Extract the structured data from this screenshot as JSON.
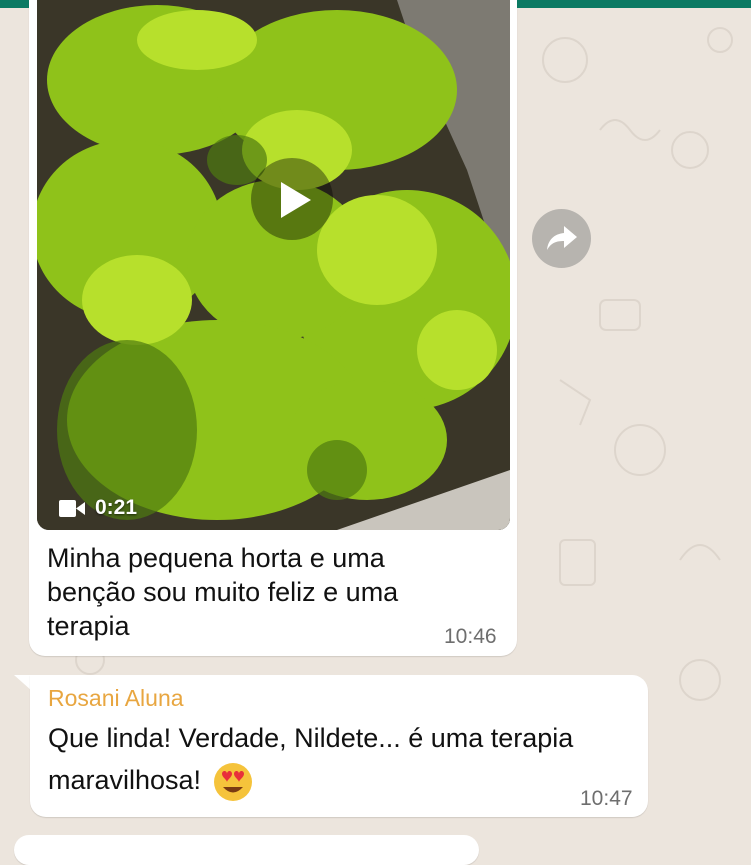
{
  "chat": {
    "video_message": {
      "duration": "0:21",
      "caption": "Minha pequena horta e uma benção sou muito feliz e uma terapia",
      "time": "10:46"
    },
    "reply_message": {
      "sender": "Rosani Aluna",
      "text": "Que linda! Verdade, Nildete... é uma terapia maravilhosa!",
      "emoji": "heart-eyes",
      "time": "10:47"
    }
  },
  "colors": {
    "header": "#0b7a63",
    "wallpaper": "#ece5dd",
    "bubble": "#ffffff",
    "sender_name": "#e8a640"
  },
  "icons": {
    "play": "play-icon",
    "video": "video-camera-icon",
    "forward": "forward-arrow-icon"
  }
}
